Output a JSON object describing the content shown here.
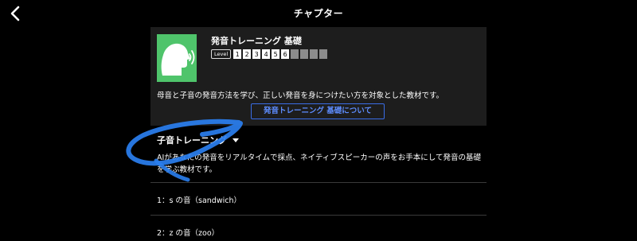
{
  "header": {
    "title": "チャプター",
    "back_icon": "chevron-left-icon"
  },
  "course": {
    "image_icon": "speaking-head-icon",
    "image_color": "#4fc46b",
    "name": "発音トレーニング 基礎",
    "level_label": "Level",
    "levels": [
      {
        "label": "1",
        "active": true
      },
      {
        "label": "2",
        "active": true
      },
      {
        "label": "3",
        "active": true
      },
      {
        "label": "4",
        "active": true
      },
      {
        "label": "5",
        "active": true
      },
      {
        "label": "6",
        "active": true
      },
      {
        "label": "",
        "active": false
      },
      {
        "label": "",
        "active": false
      },
      {
        "label": "",
        "active": false
      },
      {
        "label": "",
        "active": false
      }
    ],
    "description": "母音と子音の発音方法を学び、正しい発音を身につけたい方を対象とした教材です。",
    "about_button": "発音トレーニング 基礎について",
    "accent_color": "#3a6de6"
  },
  "section": {
    "title": "子音トレーニング",
    "dropdown_icon": "caret-down-icon",
    "description": "AIがあなたの発音をリアルタイムで採点、ネイティブスピーカーの声をお手本にして発音の基礎を学ぶ教材です。"
  },
  "lessons": [
    {
      "label": "1：s の音（sandwich）"
    },
    {
      "label": "2：z の音（zoo）"
    }
  ],
  "annotation": {
    "type": "hand-drawn-circle",
    "color": "#2a7ff0"
  }
}
